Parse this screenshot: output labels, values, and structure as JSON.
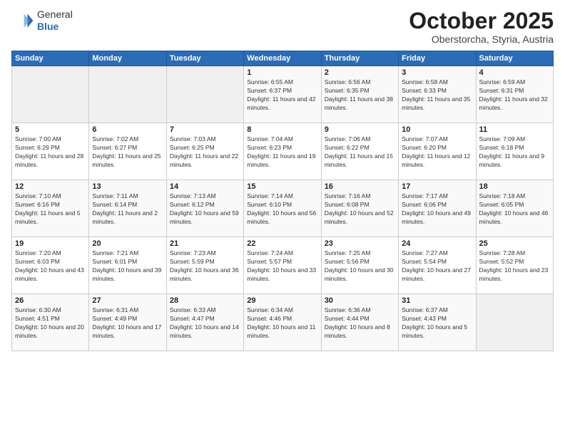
{
  "header": {
    "logo_general": "General",
    "logo_blue": "Blue",
    "month_year": "October 2025",
    "location": "Oberstorcha, Styria, Austria"
  },
  "weekdays": [
    "Sunday",
    "Monday",
    "Tuesday",
    "Wednesday",
    "Thursday",
    "Friday",
    "Saturday"
  ],
  "weeks": [
    [
      {
        "day": "",
        "info": ""
      },
      {
        "day": "",
        "info": ""
      },
      {
        "day": "",
        "info": ""
      },
      {
        "day": "1",
        "info": "Sunrise: 6:55 AM\nSunset: 6:37 PM\nDaylight: 11 hours and 42 minutes."
      },
      {
        "day": "2",
        "info": "Sunrise: 6:56 AM\nSunset: 6:35 PM\nDaylight: 11 hours and 38 minutes."
      },
      {
        "day": "3",
        "info": "Sunrise: 6:58 AM\nSunset: 6:33 PM\nDaylight: 11 hours and 35 minutes."
      },
      {
        "day": "4",
        "info": "Sunrise: 6:59 AM\nSunset: 6:31 PM\nDaylight: 11 hours and 32 minutes."
      }
    ],
    [
      {
        "day": "5",
        "info": "Sunrise: 7:00 AM\nSunset: 6:29 PM\nDaylight: 11 hours and 28 minutes."
      },
      {
        "day": "6",
        "info": "Sunrise: 7:02 AM\nSunset: 6:27 PM\nDaylight: 11 hours and 25 minutes."
      },
      {
        "day": "7",
        "info": "Sunrise: 7:03 AM\nSunset: 6:25 PM\nDaylight: 11 hours and 22 minutes."
      },
      {
        "day": "8",
        "info": "Sunrise: 7:04 AM\nSunset: 6:23 PM\nDaylight: 11 hours and 19 minutes."
      },
      {
        "day": "9",
        "info": "Sunrise: 7:06 AM\nSunset: 6:22 PM\nDaylight: 11 hours and 15 minutes."
      },
      {
        "day": "10",
        "info": "Sunrise: 7:07 AM\nSunset: 6:20 PM\nDaylight: 11 hours and 12 minutes."
      },
      {
        "day": "11",
        "info": "Sunrise: 7:09 AM\nSunset: 6:18 PM\nDaylight: 11 hours and 9 minutes."
      }
    ],
    [
      {
        "day": "12",
        "info": "Sunrise: 7:10 AM\nSunset: 6:16 PM\nDaylight: 11 hours and 5 minutes."
      },
      {
        "day": "13",
        "info": "Sunrise: 7:11 AM\nSunset: 6:14 PM\nDaylight: 11 hours and 2 minutes."
      },
      {
        "day": "14",
        "info": "Sunrise: 7:13 AM\nSunset: 6:12 PM\nDaylight: 10 hours and 59 minutes."
      },
      {
        "day": "15",
        "info": "Sunrise: 7:14 AM\nSunset: 6:10 PM\nDaylight: 10 hours and 56 minutes."
      },
      {
        "day": "16",
        "info": "Sunrise: 7:16 AM\nSunset: 6:08 PM\nDaylight: 10 hours and 52 minutes."
      },
      {
        "day": "17",
        "info": "Sunrise: 7:17 AM\nSunset: 6:06 PM\nDaylight: 10 hours and 49 minutes."
      },
      {
        "day": "18",
        "info": "Sunrise: 7:18 AM\nSunset: 6:05 PM\nDaylight: 10 hours and 46 minutes."
      }
    ],
    [
      {
        "day": "19",
        "info": "Sunrise: 7:20 AM\nSunset: 6:03 PM\nDaylight: 10 hours and 43 minutes."
      },
      {
        "day": "20",
        "info": "Sunrise: 7:21 AM\nSunset: 6:01 PM\nDaylight: 10 hours and 39 minutes."
      },
      {
        "day": "21",
        "info": "Sunrise: 7:23 AM\nSunset: 5:59 PM\nDaylight: 10 hours and 36 minutes."
      },
      {
        "day": "22",
        "info": "Sunrise: 7:24 AM\nSunset: 5:57 PM\nDaylight: 10 hours and 33 minutes."
      },
      {
        "day": "23",
        "info": "Sunrise: 7:25 AM\nSunset: 5:56 PM\nDaylight: 10 hours and 30 minutes."
      },
      {
        "day": "24",
        "info": "Sunrise: 7:27 AM\nSunset: 5:54 PM\nDaylight: 10 hours and 27 minutes."
      },
      {
        "day": "25",
        "info": "Sunrise: 7:28 AM\nSunset: 5:52 PM\nDaylight: 10 hours and 23 minutes."
      }
    ],
    [
      {
        "day": "26",
        "info": "Sunrise: 6:30 AM\nSunset: 4:51 PM\nDaylight: 10 hours and 20 minutes."
      },
      {
        "day": "27",
        "info": "Sunrise: 6:31 AM\nSunset: 4:49 PM\nDaylight: 10 hours and 17 minutes."
      },
      {
        "day": "28",
        "info": "Sunrise: 6:33 AM\nSunset: 4:47 PM\nDaylight: 10 hours and 14 minutes."
      },
      {
        "day": "29",
        "info": "Sunrise: 6:34 AM\nSunset: 4:46 PM\nDaylight: 10 hours and 11 minutes."
      },
      {
        "day": "30",
        "info": "Sunrise: 6:36 AM\nSunset: 4:44 PM\nDaylight: 10 hours and 8 minutes."
      },
      {
        "day": "31",
        "info": "Sunrise: 6:37 AM\nSunset: 4:43 PM\nDaylight: 10 hours and 5 minutes."
      },
      {
        "day": "",
        "info": ""
      }
    ]
  ]
}
